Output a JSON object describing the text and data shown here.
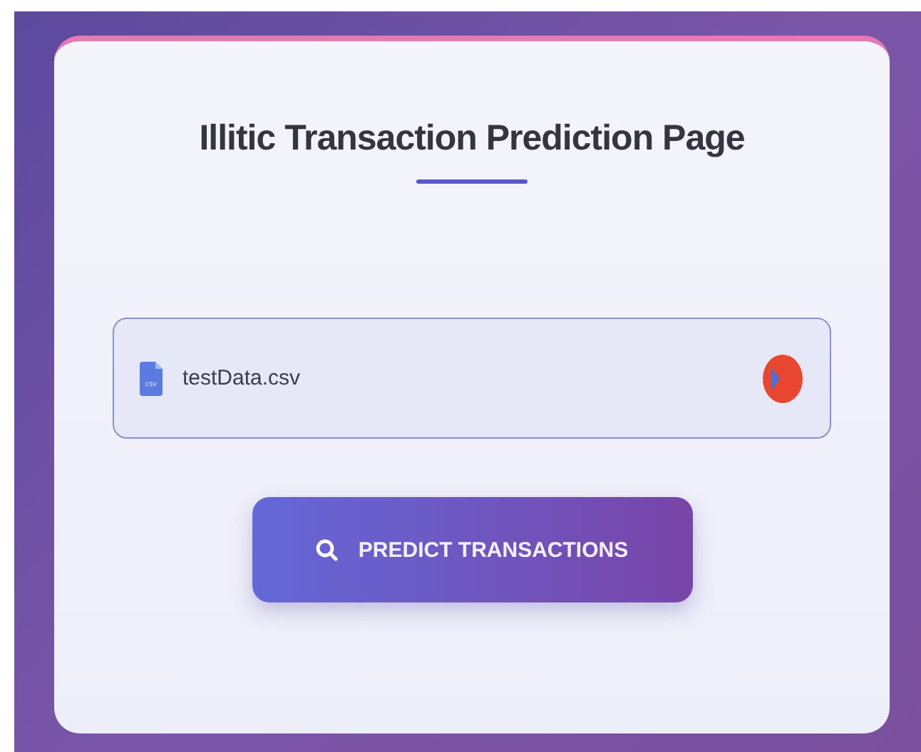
{
  "title": "Illitic Transaction Prediction Page",
  "file_input": {
    "file_icon_label": "csv",
    "value": "testData.csv"
  },
  "button": {
    "label": "PREDICT TRANSACTIONS"
  }
}
